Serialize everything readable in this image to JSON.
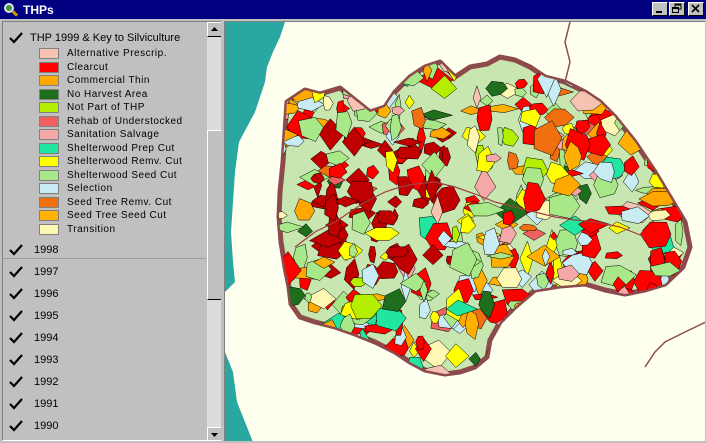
{
  "window": {
    "title": "THPs",
    "icon": "arcview-magnifier-icon",
    "controls": [
      "minimize",
      "restore",
      "close"
    ]
  },
  "toc": {
    "active_layer": {
      "label": "THP 1999 & Key to Silviculture",
      "checked": true
    },
    "legend": [
      {
        "label": "Alternative Prescrip.",
        "color": "#f6c2b2"
      },
      {
        "label": "Clearcut",
        "color": "#ff0000"
      },
      {
        "label": "Commercial Thin",
        "color": "#ffa800"
      },
      {
        "label": "No Harvest Area",
        "color": "#1e6e1e"
      },
      {
        "label": "Not Part of THP",
        "color": "#b4ee00"
      },
      {
        "label": "Rehab of Understocked",
        "color": "#f06060"
      },
      {
        "label": "Sanitation Salvage",
        "color": "#f4a8a8"
      },
      {
        "label": "Shelterwood Prep Cut",
        "color": "#20e6a0"
      },
      {
        "label": "Shelterwood Remv. Cut",
        "color": "#ffff00"
      },
      {
        "label": "Shelterwood Seed Cut",
        "color": "#a8e888"
      },
      {
        "label": "Selection",
        "color": "#c8ecf4"
      },
      {
        "label": "Seed Tree Remv. Cut",
        "color": "#f07010"
      },
      {
        "label": "Seed Tree Seed Cut",
        "color": "#ffb000"
      },
      {
        "label": "Transition",
        "color": "#fff8b4"
      }
    ],
    "layers": [
      {
        "label": "1998",
        "checked": true
      },
      {
        "label": "1997",
        "checked": true
      },
      {
        "label": "1996",
        "checked": true
      },
      {
        "label": "1995",
        "checked": true
      },
      {
        "label": "1994",
        "checked": true
      },
      {
        "label": "1993",
        "checked": true
      },
      {
        "label": "1992",
        "checked": true
      },
      {
        "label": "1991",
        "checked": true
      },
      {
        "label": "1990",
        "checked": true
      }
    ]
  },
  "colors": {
    "titlebar": "#000080",
    "ocean": "#2aa7a0",
    "land": "#fffff0",
    "watershed_border": "#8c4a4a",
    "forest_base": "#c8e6b0",
    "river": "#a04040"
  }
}
